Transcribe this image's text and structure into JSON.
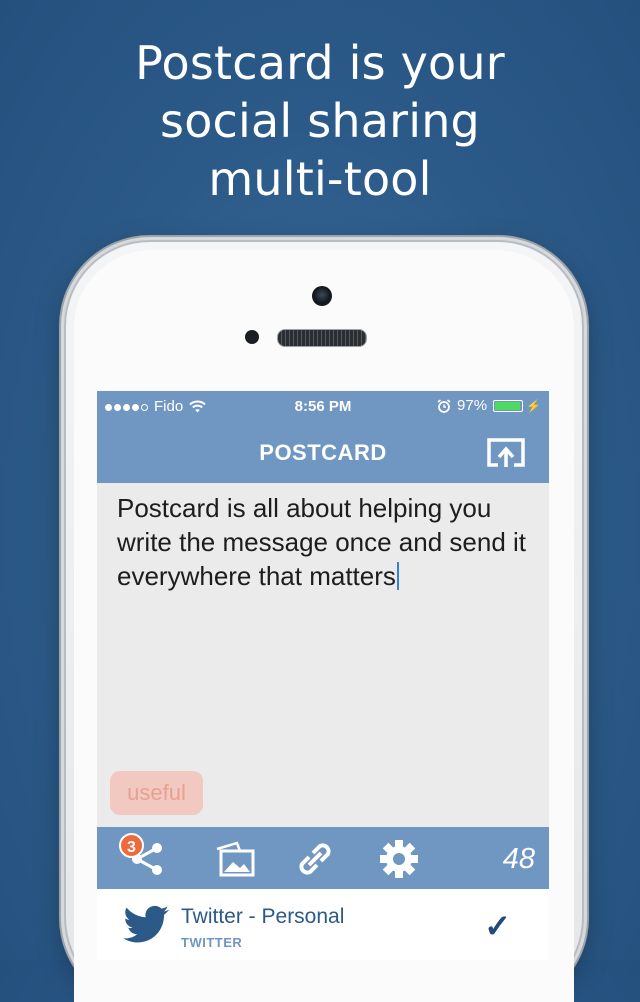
{
  "headline": [
    "Postcard is your",
    "social sharing",
    "multi-tool"
  ],
  "status_bar": {
    "carrier": "Fido",
    "time": "8:56 PM",
    "battery": "97%",
    "battery_level": 0.97
  },
  "nav": {
    "title": "POSTCARD",
    "right_icon": "share-out-icon"
  },
  "compose": {
    "text": "Postcard is all about helping you write the message once and send it everywhere that matters"
  },
  "tag": {
    "label": "useful"
  },
  "toolbar": {
    "badge_count": "3",
    "icons": [
      "share-icon",
      "image-icon",
      "link-icon",
      "gear-icon"
    ],
    "char_count": "48"
  },
  "account": {
    "name": "Twitter - Personal",
    "service": "TWITTER",
    "icon": "twitter-bird-icon",
    "checked": true
  },
  "colors": {
    "background": "#2c5a88",
    "bar": "#7097c2",
    "badge": "#ef6a3a",
    "tag_bg": "#f1c9c0"
  }
}
